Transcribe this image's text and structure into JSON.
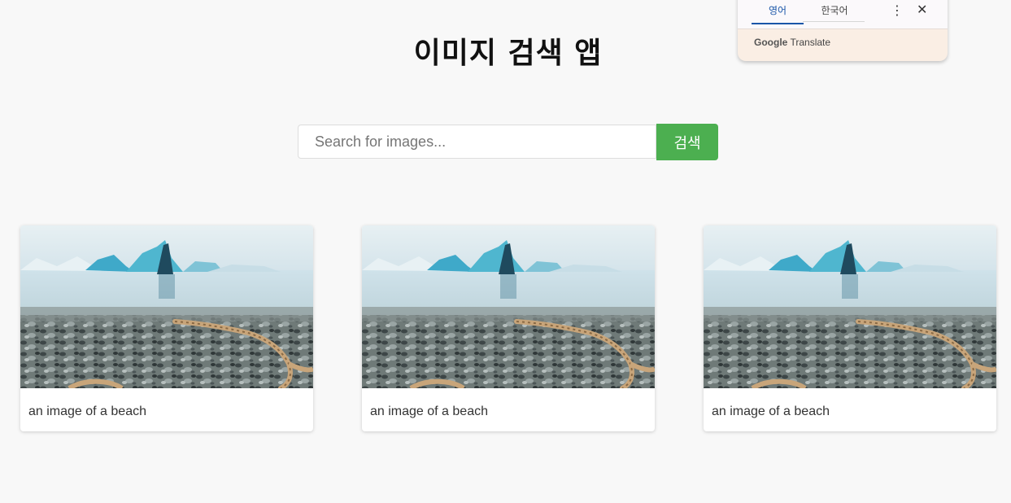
{
  "header": {
    "title": "이미지 검색 앱"
  },
  "search": {
    "placeholder": "Search for images...",
    "value": "",
    "button_label": "검색"
  },
  "results": [
    {
      "caption": "an image of a beach"
    },
    {
      "caption": "an image of a beach"
    },
    {
      "caption": "an image of a beach"
    }
  ],
  "translate_popup": {
    "tabs": [
      "영어",
      "한국어"
    ],
    "active_tab": "영어",
    "brand_google": "Google",
    "brand_translate": "Translate",
    "more_icon": "more-vert-icon",
    "close_icon": "close-icon"
  },
  "colors": {
    "accent": "#4caf50",
    "background": "#f8f8f8",
    "translate_active": "#1a56a8"
  }
}
